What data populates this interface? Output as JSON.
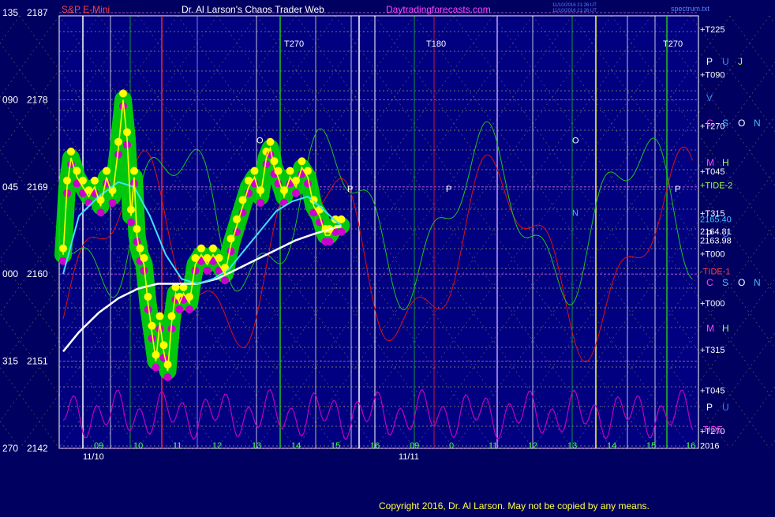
{
  "header": {
    "instrument": "S&P E-Mini",
    "title": "Dr. Al Larson's Chaos Trader Web",
    "site": "Daytradingforecasts.com",
    "stamp_line1": "11/10/2016 21:26 UT",
    "stamp_line2": "11/10/2016 21:26 UT",
    "spec_file": "spectrum.txt"
  },
  "footer": {
    "copyright": "Copyright 2016, Dr. Al Larson. May not be copied by any means."
  },
  "colors": {
    "background": "#000060",
    "plot_background": "#000080",
    "price_line": "#ffff00",
    "green_band": "#00dd00",
    "magenta_dots": "#cc00cc",
    "cyan_ma": "#40e0ff",
    "white_ma": "#ffffff",
    "red_flux": "#dd1010",
    "green_flux": "#20c020",
    "tide_magenta": "#c000c0",
    "grid_dotted": "#d8d860",
    "label_white": "#ffffff",
    "label_magenta": "#ff44ff",
    "label_blue": "#4080ff",
    "label_cyan": "#40c0ff",
    "label_yellow_green": "#a0ff40"
  },
  "chart_data": {
    "type": "line",
    "title": "Dr. Al Larson's Chaos Trader Web",
    "instrument": "S&P E-Mini",
    "ylim": [
      2142,
      2187
    ],
    "grid": true,
    "y_axis_labels": [
      {
        "angle": "135",
        "price": "2187",
        "value": 2187
      },
      {
        "angle": "090",
        "price": "2178",
        "value": 2178
      },
      {
        "angle": "045",
        "price": "2169",
        "value": 2169
      },
      {
        "angle": "000",
        "price": "2160",
        "value": 2160
      },
      {
        "angle": "315",
        "price": "2151",
        "value": 2151
      },
      {
        "angle": "270",
        "price": "2142",
        "value": 2142
      }
    ],
    "x_tick_labels": [
      {
        "label": "09",
        "hour": 9.0
      },
      {
        "label": "10",
        "hour": 10.0
      },
      {
        "label": "11",
        "hour": 11.0
      },
      {
        "label": "12",
        "hour": 12.0
      },
      {
        "label": "13",
        "hour": 13.0
      },
      {
        "label": "14",
        "hour": 14.0
      },
      {
        "label": "15",
        "hour": 15.0
      },
      {
        "label": "16",
        "hour": 16.0
      },
      {
        "label": "09",
        "hour": 17.0
      },
      {
        "label": "0",
        "hour": 18.0
      },
      {
        "label": "11",
        "hour": 19.0
      },
      {
        "label": "12",
        "hour": 20.0
      },
      {
        "label": "13",
        "hour": 21.0
      },
      {
        "label": "14",
        "hour": 22.0
      },
      {
        "label": "15",
        "hour": 23.0
      },
      {
        "label": "16",
        "hour": 24.0
      }
    ],
    "date_labels": [
      {
        "label": "11/10",
        "hour": 9.0
      },
      {
        "label": "11/11",
        "hour": 17.0
      }
    ],
    "price_series": {
      "name": "S&P E-Mini",
      "points": [
        [
          8.1,
          2162
        ],
        [
          8.2,
          2169
        ],
        [
          8.3,
          2172
        ],
        [
          8.45,
          2170
        ],
        [
          8.6,
          2169
        ],
        [
          8.75,
          2168
        ],
        [
          8.9,
          2169
        ],
        [
          9.05,
          2167
        ],
        [
          9.2,
          2170
        ],
        [
          9.35,
          2168
        ],
        [
          9.5,
          2173
        ],
        [
          9.62,
          2178
        ],
        [
          9.72,
          2174
        ],
        [
          9.82,
          2166
        ],
        [
          9.9,
          2170
        ],
        [
          9.97,
          2164
        ],
        [
          10.05,
          2162
        ],
        [
          10.15,
          2161
        ],
        [
          10.25,
          2157
        ],
        [
          10.35,
          2154
        ],
        [
          10.45,
          2151
        ],
        [
          10.55,
          2155
        ],
        [
          10.65,
          2152
        ],
        [
          10.75,
          2150
        ],
        [
          10.85,
          2155
        ],
        [
          10.95,
          2158
        ],
        [
          11.05,
          2157
        ],
        [
          11.15,
          2158
        ],
        [
          11.3,
          2157
        ],
        [
          11.45,
          2161
        ],
        [
          11.6,
          2162
        ],
        [
          11.75,
          2161
        ],
        [
          11.9,
          2162
        ],
        [
          12.05,
          2161
        ],
        [
          12.2,
          2160
        ],
        [
          12.35,
          2163
        ],
        [
          12.5,
          2165
        ],
        [
          12.65,
          2167
        ],
        [
          12.8,
          2169
        ],
        [
          12.95,
          2170
        ],
        [
          13.1,
          2168
        ],
        [
          13.25,
          2172
        ],
        [
          13.35,
          2173
        ],
        [
          13.45,
          2171
        ],
        [
          13.55,
          2170
        ],
        [
          13.7,
          2168
        ],
        [
          13.85,
          2170
        ],
        [
          14.0,
          2169
        ],
        [
          14.15,
          2171
        ],
        [
          14.3,
          2170
        ],
        [
          14.45,
          2167
        ],
        [
          14.6,
          2166
        ],
        [
          14.75,
          2164
        ],
        [
          14.85,
          2164
        ],
        [
          15.0,
          2165
        ],
        [
          15.15,
          2165
        ]
      ]
    },
    "ma_fast": {
      "name": "",
      "points": [
        [
          8.1,
          2160
        ],
        [
          8.5,
          2166
        ],
        [
          9.0,
          2168
        ],
        [
          9.5,
          2169.5
        ],
        [
          9.9,
          2169
        ],
        [
          10.3,
          2166
        ],
        [
          10.7,
          2162
        ],
        [
          11.1,
          2159.5
        ],
        [
          11.5,
          2159
        ],
        [
          11.9,
          2159.5
        ],
        [
          12.3,
          2160.5
        ],
        [
          12.7,
          2162.5
        ],
        [
          13.1,
          2164.5
        ],
        [
          13.5,
          2166.5
        ],
        [
          13.9,
          2167.5
        ],
        [
          14.3,
          2168
        ],
        [
          14.6,
          2167
        ],
        [
          15.0,
          2165.5
        ],
        [
          15.15,
          2165
        ]
      ]
    },
    "ma_slow": {
      "name": "",
      "points": [
        [
          8.1,
          2152
        ],
        [
          8.5,
          2154
        ],
        [
          9.0,
          2156
        ],
        [
          9.5,
          2157.5
        ],
        [
          10.0,
          2158.5
        ],
        [
          10.5,
          2159
        ],
        [
          11.0,
          2159
        ],
        [
          11.5,
          2159
        ],
        [
          12.0,
          2159.5
        ],
        [
          12.5,
          2160.5
        ],
        [
          13.0,
          2161.5
        ],
        [
          13.5,
          2162.5
        ],
        [
          14.0,
          2163.5
        ],
        [
          14.5,
          2164.2
        ],
        [
          15.0,
          2164.8
        ],
        [
          15.15,
          2164.9
        ]
      ]
    },
    "right_labels": [
      {
        "text": "+T225",
        "price": 2185.3,
        "color": "#ffffff"
      },
      {
        "text": "+T090",
        "price": 2180.6,
        "color": "#ffffff"
      },
      {
        "text": "+T270",
        "price": 2175.3,
        "color": "#ffffff"
      },
      {
        "text": "+T045",
        "price": 2170.6,
        "color": "#ffffff"
      },
      {
        "text": "+TIDE-2",
        "price": 2169.2,
        "color": "#a0ff40"
      },
      {
        "text": "+T315",
        "price": 2166.3,
        "color": "#ffffff"
      },
      {
        "text": "2165.40",
        "price": 2165.7,
        "color": "#40c0ff"
      },
      {
        "text": "2164.81",
        "price": 2164.4,
        "color": "#ffffff"
      },
      {
        "text": "2163.98",
        "price": 2163.5,
        "color": "#ffffff"
      },
      {
        "text": "+T000",
        "price": 2162.1,
        "color": "#ffffff"
      },
      {
        "text": "-TIDE-1",
        "price": 2160.3,
        "color": "#ff4040"
      },
      {
        "text": "+T000",
        "price": 2157.0,
        "color": "#ffffff"
      },
      {
        "text": "+T315",
        "price": 2152.2,
        "color": "#ffffff"
      },
      {
        "text": "+T045",
        "price": 2148.0,
        "color": "#ffffff"
      },
      {
        "text": "+T270",
        "price": 2143.8,
        "color": "#ffffff"
      },
      {
        "text": "-TIDE",
        "price": 2144.0,
        "color": "#ff44ff"
      },
      {
        "text": "2016",
        "price": 2142.3,
        "color": "#ffffff"
      }
    ],
    "planet_glyphs": [
      {
        "text": "P",
        "color": "#ffffff",
        "row": 1
      },
      {
        "text": "U",
        "color": "#4080ff",
        "row": 1
      },
      {
        "text": "J",
        "color": "#a0ff40",
        "row": 1
      },
      {
        "text": "V",
        "color": "#4080ff",
        "row": 2
      },
      {
        "text": "C",
        "color": "#ff44ff",
        "row": 3
      },
      {
        "text": "S",
        "color": "#40c0ff",
        "row": 3
      },
      {
        "text": "O",
        "color": "#ffffff",
        "row": 3
      },
      {
        "text": "N",
        "color": "#40c0ff",
        "row": 3
      },
      {
        "text": "M",
        "color": "#ff44ff",
        "row": 4
      },
      {
        "text": "H",
        "color": "#a0ff40",
        "row": 4
      },
      {
        "text": "P",
        "color": "#ffffff",
        "row": 5
      },
      {
        "text": "U",
        "color": "#4080ff",
        "row": 5
      },
      {
        "text": "C",
        "color": "#ff44ff",
        "row": 6
      },
      {
        "text": "S",
        "color": "#40c0ff",
        "row": 6
      },
      {
        "text": "O",
        "color": "#ffffff",
        "row": 6
      },
      {
        "text": "N",
        "color": "#40c0ff",
        "row": 6
      },
      {
        "text": "M",
        "color": "#ff44ff",
        "row": 7
      },
      {
        "text": "H",
        "color": "#a0ff40",
        "row": 7
      },
      {
        "text": "P",
        "color": "#ffffff",
        "row": 8
      },
      {
        "text": "U",
        "color": "#4080ff",
        "row": 8
      }
    ],
    "in_plot_labels": [
      {
        "text": "T270",
        "hour": 13.7,
        "price": 2183.5,
        "color": "#ffffff"
      },
      {
        "text": "T180",
        "hour": 17.3,
        "price": 2183.5,
        "color": "#ffffff"
      },
      {
        "text": "T270",
        "hour": 23.3,
        "price": 2183.5,
        "color": "#ffffff"
      },
      {
        "text": "O",
        "hour": 13.0,
        "price": 2173.5,
        "color": "#ffffff"
      },
      {
        "text": "O",
        "hour": 21.0,
        "price": 2173.5,
        "color": "#ffffff"
      },
      {
        "text": "P",
        "hour": 15.3,
        "price": 2168.5,
        "color": "#ffffff"
      },
      {
        "text": "P",
        "hour": 17.8,
        "price": 2168.5,
        "color": "#ffffff"
      },
      {
        "text": "P",
        "hour": 23.6,
        "price": 2168.5,
        "color": "#ffffff"
      },
      {
        "text": "N",
        "hour": 21.0,
        "price": 2166.0,
        "color": "#40c0ff"
      }
    ]
  }
}
